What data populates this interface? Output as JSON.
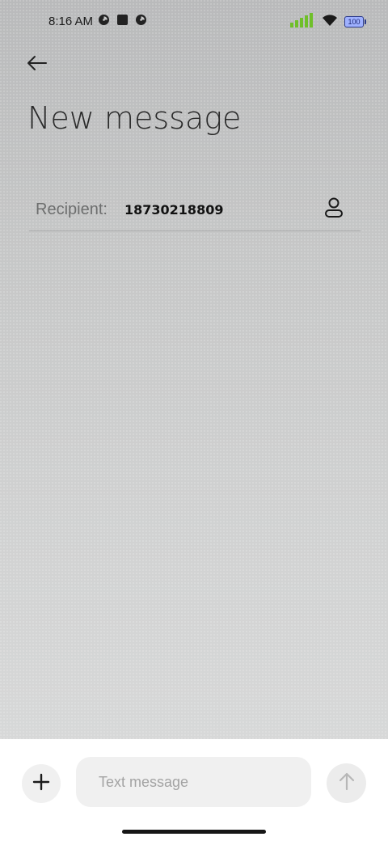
{
  "status_bar": {
    "time": "8:16 AM",
    "battery_level": "100",
    "left_icons": [
      "notification-circle-icon",
      "square-app-icon",
      "notification-circle-icon"
    ],
    "right_icons": [
      "cellular-signal-icon",
      "wifi-icon",
      "battery-icon"
    ],
    "signal_color": "#6fbf2a",
    "battery_color": "#9fb1ff"
  },
  "header": {
    "back_icon": "arrow-left-icon",
    "title": "New message"
  },
  "recipient": {
    "label": "Recipient:",
    "value": "18730218809",
    "contact_icon": "person-icon"
  },
  "composer": {
    "add_icon": "plus-icon",
    "placeholder": "Text message",
    "value": "",
    "send_icon": "arrow-up-icon"
  }
}
